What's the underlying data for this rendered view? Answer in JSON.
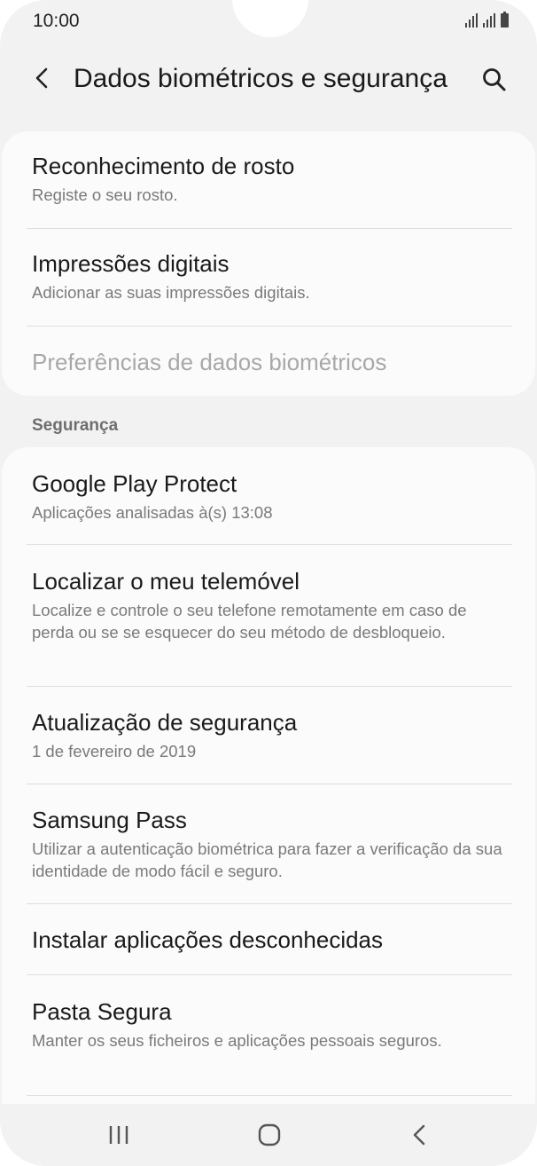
{
  "status_bar": {
    "time": "10:00",
    "icons": [
      "signal-icon",
      "signal-icon",
      "battery-icon"
    ]
  },
  "header": {
    "title": "Dados biométricos e segurança",
    "back_icon": "back-arrow-icon",
    "search_icon": "search-icon"
  },
  "biometrics": {
    "items": [
      {
        "title": "Reconhecimento de rosto",
        "subtitle": "Registe o seu rosto."
      },
      {
        "title": "Impressões digitais",
        "subtitle": "Adicionar as suas impressões digitais."
      },
      {
        "title": "Preferências de dados biométricos",
        "subtitle": ""
      }
    ]
  },
  "security": {
    "label": "Segurança",
    "items": [
      {
        "title": "Google Play Protect",
        "subtitle": "Aplicações analisadas à(s) 13:08"
      },
      {
        "title": "Localizar o meu telemóvel",
        "subtitle": "Localize e controle o seu telefone remotamente em caso de perda ou se se esquecer do seu método de desbloqueio."
      },
      {
        "title": "Atualização de segurança",
        "subtitle": "1 de fevereiro de 2019"
      },
      {
        "title": "Samsung Pass",
        "subtitle": "Utilizar a autenticação biométrica para fazer a verificação da sua identidade de modo fácil e seguro."
      },
      {
        "title": "Instalar aplicações desconhecidas",
        "subtitle": ""
      },
      {
        "title": "Pasta Segura",
        "subtitle": "Manter os seus ficheiros e aplicações pessoais seguros."
      }
    ]
  },
  "nav_bar": {
    "icons": [
      "recent-apps-icon",
      "home-icon",
      "back-icon"
    ]
  }
}
